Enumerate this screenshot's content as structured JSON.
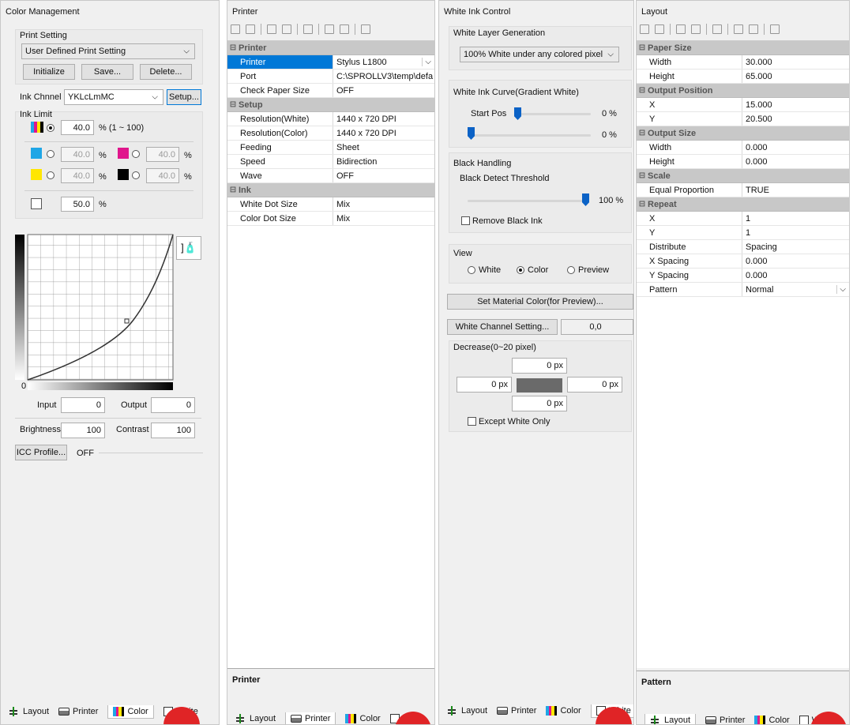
{
  "tabs": {
    "layout": "Layout",
    "printer": "Printer",
    "color": "Color",
    "white": "White"
  },
  "color_management": {
    "title": "Color Management",
    "print_setting_label": "Print Setting",
    "print_setting_value": "User Defined Print Setting",
    "initialize_label": "Initialize",
    "save_label": "Save...",
    "delete_label": "Delete...",
    "ink_channel_label": "Ink Chnnel",
    "ink_channel_value": "YKLcLmMC",
    "setup_label": "Setup...",
    "ink_limit_label": "Ink Limit",
    "all_value": "40.0",
    "all_range": "% (1 ~ 100)",
    "cyan_value": "40.0",
    "magenta_value": "40.0",
    "yellow_value": "40.0",
    "black_value": "40.0",
    "white_value": "50.0",
    "pct": "%",
    "curve_zero": "0",
    "input_label": "Input",
    "input_value": "0",
    "output_label": "Output",
    "output_value": "0",
    "brightness_label": "Brightness",
    "brightness_value": "100",
    "contrast_label": "Contrast",
    "contrast_value": "100",
    "icc_label": "ICC Profile...",
    "icc_value": "OFF"
  },
  "printer_panel": {
    "title": "Printer",
    "categories": [
      {
        "name": "Printer",
        "rows": [
          {
            "key": "Printer",
            "value": "Stylus L1800"
          },
          {
            "key": "Port",
            "value": "C:\\SPROLLV3\\temp\\defa"
          },
          {
            "key": "Check Paper Size",
            "value": "OFF"
          }
        ]
      },
      {
        "name": "Setup",
        "rows": [
          {
            "key": "Resolution(White)",
            "value": "1440 x 720 DPI"
          },
          {
            "key": "Resolution(Color)",
            "value": "1440 x 720 DPI"
          },
          {
            "key": "Feeding",
            "value": "Sheet"
          },
          {
            "key": "Speed",
            "value": "Bidirection"
          },
          {
            "key": "Wave",
            "value": "OFF"
          }
        ]
      },
      {
        "name": "Ink",
        "rows": [
          {
            "key": "White Dot Size",
            "value": "Mix"
          },
          {
            "key": "Color Dot Size",
            "value": "Mix"
          }
        ]
      }
    ],
    "description": "Printer"
  },
  "white_ink": {
    "title": "White Ink Control",
    "layer_gen_label": "White Layer Generation",
    "layer_gen_value": "100% White under any colored pixel",
    "curve_label": "White Ink Curve(Gradient White)",
    "start_pos_label": "Start Pos",
    "start_pos_value": "0 %",
    "end_value": "0 %",
    "black_handling_label": "Black Handling",
    "black_threshold_label": "Black Detect Threshold",
    "black_threshold_value": "100 %",
    "remove_black_label": "Remove Black Ink",
    "view_label": "View",
    "view_white": "White",
    "view_color": "Color",
    "view_preview": "Preview",
    "set_material_label": "Set Material Color(for Preview)...",
    "white_channel_label": "White Channel Setting...",
    "white_channel_value": "0,0",
    "decrease_label": "Decrease(0~20 pixel)",
    "top_px": "0 px",
    "left_px": "0 px",
    "right_px": "0 px",
    "bottom_px": "0 px",
    "except_white_label": "Except White Only"
  },
  "layout_panel": {
    "title": "Layout",
    "categories": [
      {
        "name": "Paper Size",
        "rows": [
          {
            "key": "Width",
            "value": "30.000"
          },
          {
            "key": "Height",
            "value": "65.000"
          }
        ]
      },
      {
        "name": "Output Position",
        "rows": [
          {
            "key": "X",
            "value": "15.000"
          },
          {
            "key": "Y",
            "value": "20.500"
          }
        ]
      },
      {
        "name": "Output Size",
        "rows": [
          {
            "key": "Width",
            "value": "0.000"
          },
          {
            "key": "Height",
            "value": "0.000"
          }
        ]
      },
      {
        "name": "Scale",
        "rows": [
          {
            "key": "Equal Proportion",
            "value": "TRUE"
          }
        ]
      },
      {
        "name": "Repeat",
        "rows": [
          {
            "key": "X",
            "value": "1"
          },
          {
            "key": "Y",
            "value": "1"
          },
          {
            "key": "Distribute",
            "value": "Spacing"
          },
          {
            "key": "X Spacing",
            "value": "0.000"
          },
          {
            "key": "Y Spacing",
            "value": "0.000"
          },
          {
            "key": "Pattern",
            "value": "Normal"
          }
        ]
      }
    ],
    "description": "Pattern"
  },
  "colors": {
    "cyan": "#1fa6e6",
    "magenta": "#e0168c",
    "yellow": "#ffe600",
    "black": "#000000",
    "accent": "#0078d7",
    "red": "#e02426"
  },
  "icons": [
    "printer-icon",
    "layout-icon",
    "color-bars-icon",
    "white-box-icon",
    "toolbar-align-icon",
    "tube-icon"
  ]
}
